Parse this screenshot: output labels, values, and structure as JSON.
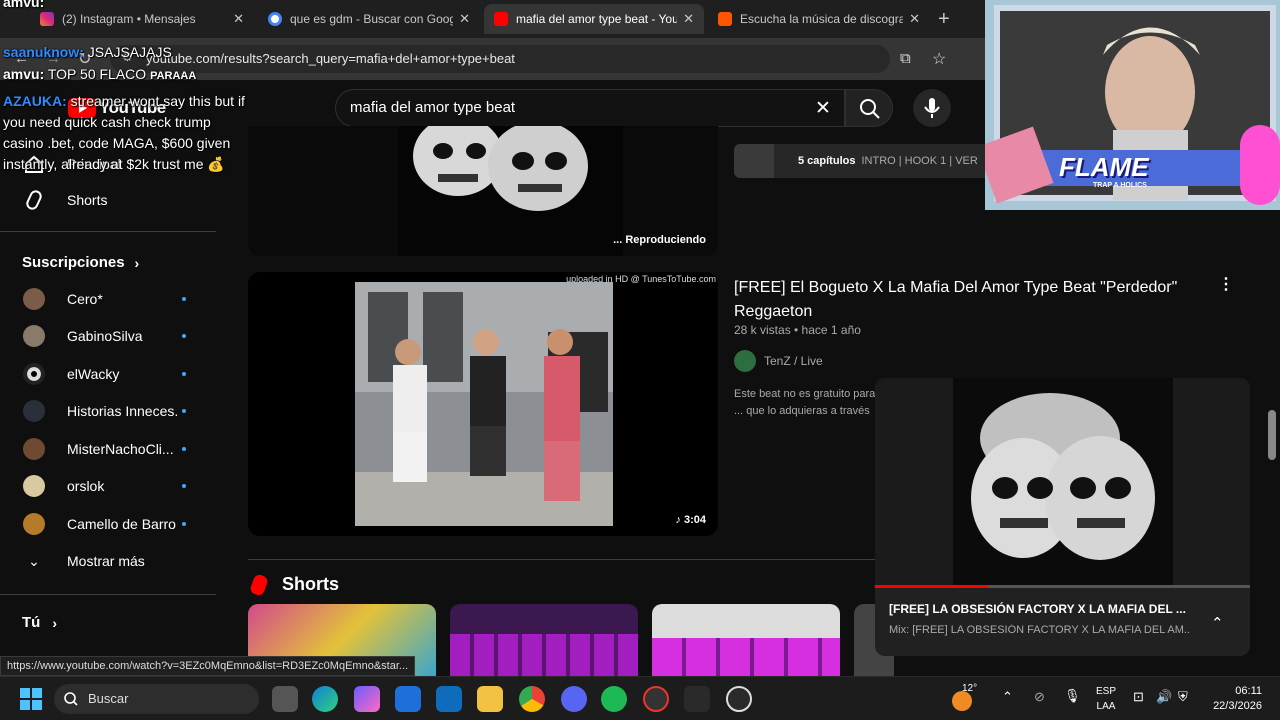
{
  "browser": {
    "tabs": [
      {
        "title": "(2) Instagram • Mensajes",
        "active": false,
        "favicon": "instagram-icon"
      },
      {
        "title": "que es gdm - Buscar con Google",
        "active": false,
        "favicon": "google-icon"
      },
      {
        "title": "mafia del amor type beat - YouTube",
        "active": true,
        "favicon": "youtube-icon"
      },
      {
        "title": "Escucha la música de discografías",
        "active": false,
        "favicon": "soundcloud-icon"
      }
    ],
    "new_tab": "+",
    "url": "youtube.com/results?search_query=mafia+del+amor+type+beat"
  },
  "youtube": {
    "logo": "YouTube",
    "search_value": "mafia del amor type beat",
    "sidebar": {
      "top": [
        {
          "label": "Principal",
          "icon": "home-icon"
        },
        {
          "label": "Shorts",
          "icon": "shorts-icon"
        }
      ],
      "subs_heading": "Suscripciones",
      "subs": [
        {
          "label": "Cero*",
          "color": "#7a5c48"
        },
        {
          "label": "GabinoSilva",
          "color": "#8a7a6a"
        },
        {
          "label": "elWacky",
          "color": "#dddddd"
        },
        {
          "label": "Historias Inneces...",
          "color": "#2a2f3a"
        },
        {
          "label": "MisterNachoCli...",
          "color": "#6e4a32"
        },
        {
          "label": "orslok",
          "color": "#d8c9a0"
        },
        {
          "label": "Camello de Barro",
          "color": "#b57a2a"
        }
      ],
      "show_more": "Mostrar más",
      "you": "Tú"
    },
    "top_video": {
      "status": "Reproduciendo",
      "chapters_count": "5 capítulos",
      "chapters_text": "INTRO | HOOK 1 | VER"
    },
    "video": {
      "title": "[FREE] El Bogueto X La Mafia Del Amor Type Beat \"Perdedor\" Reggaeton",
      "meta": "28 k vistas • hace 1 año",
      "channel": "TenZ / Live",
      "desc": "Este beat no es gratuito para ... que lo adquieras a través de",
      "duration": "3:04",
      "watermark": "uploaded in HD @ TunesToTube.com"
    },
    "shorts_label": "Shorts",
    "miniplayer": {
      "title": "[FREE] LA OBSESIÓN FACTORY X LA MAFIA DEL ...",
      "subtitle": "Mix: [FREE] LA OBSESIÓN FACTORY X LA MAFIA DEL AM...",
      "progress": 0.3
    }
  },
  "stream": {
    "chat": [
      {
        "user": "amvu:",
        "msg": "",
        "color": "#ffffff"
      },
      {
        "user": "saanuknow:",
        "msg": " JSAJSAJAJS",
        "color": "#2f8bff"
      },
      {
        "user": "amvu:",
        "msg": " TOP 50 FLACO",
        "color": "#ffffff"
      },
      {
        "user": "AZAUKA:",
        "msg": " streamer wont say this but if",
        "color": "#2f8bff"
      },
      {
        "user": "",
        "msg": "you need quick cash check trump",
        "color": ""
      },
      {
        "user": "",
        "msg": "casino .bet, code MAGA, $600 given",
        "color": ""
      },
      {
        "user": "",
        "msg": "instantly, already at $2k trust me 💰",
        "color": ""
      }
    ],
    "overlay_word": "PARAAA",
    "webcam_banner": "FLAME",
    "webcam_banner_sub": "TRAP A HOLICS"
  },
  "status_url": "https://www.youtube.com/watch?v=3EZc0MqEmno&list=RD3EZc0MqEmno&star...",
  "taskbar": {
    "search_placeholder": "Buscar",
    "temperature": "12°",
    "lang": "ESP",
    "lang2": "LAA",
    "time": "06:11",
    "date": "22/3/2026"
  }
}
